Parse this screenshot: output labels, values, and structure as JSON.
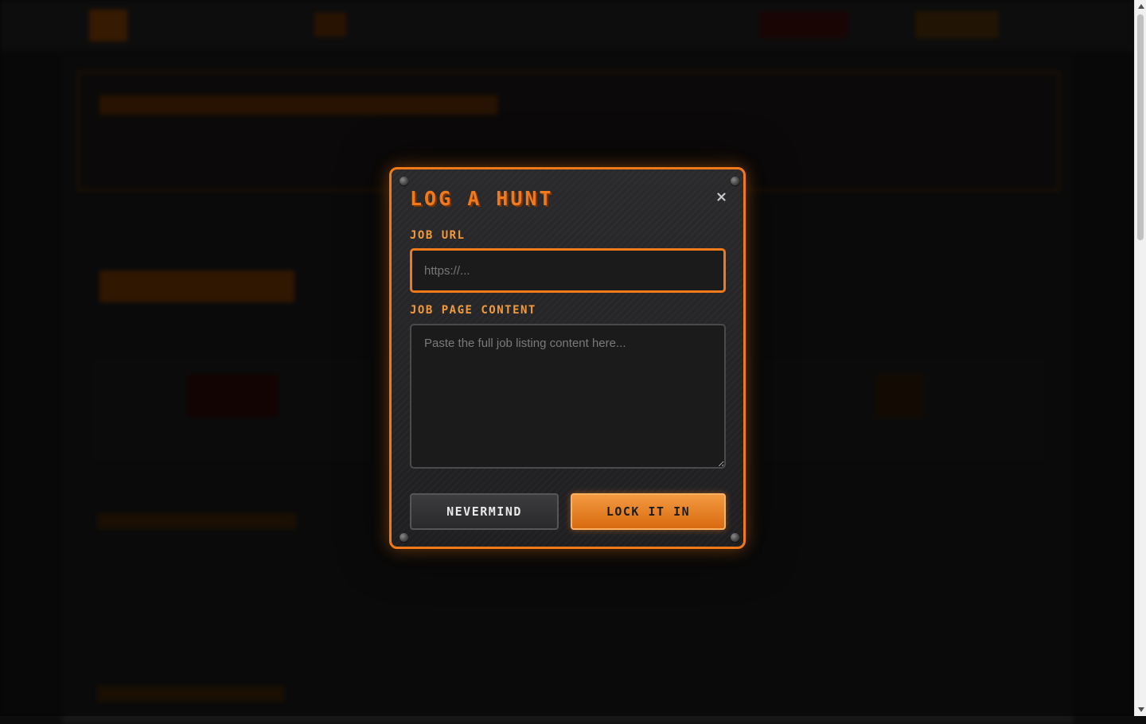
{
  "modal": {
    "title": "LOG A HUNT",
    "close_icon": "close-icon",
    "url_label": "JOB URL",
    "url_placeholder": "https://...",
    "url_value": "",
    "content_label": "JOB PAGE CONTENT",
    "content_placeholder": "Paste the full job listing content here...",
    "content_value": "",
    "cancel_label": "NEVERMIND",
    "confirm_label": "LOCK IT IN"
  },
  "colors": {
    "accent": "#f07a1a",
    "label": "#f29a3c",
    "panel": "#252527",
    "background": "#121212"
  }
}
